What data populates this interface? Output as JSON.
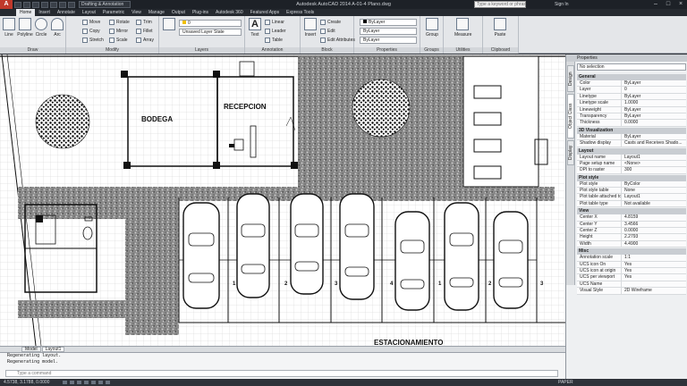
{
  "titlebar": {
    "logo_letter": "A",
    "workspace": "Drafting & Annotation",
    "title": "Autodesk AutoCAD 2014    A-01-4 Plano.dwg",
    "search_placeholder": "Type a keyword or phrase",
    "signin_label": "Sign In",
    "minimize": "–",
    "maximize": "□",
    "close": "×"
  },
  "ribbon_tabs": [
    "Home",
    "Insert",
    "Annotate",
    "Layout",
    "Parametric",
    "View",
    "Manage",
    "Output",
    "Plug-ins",
    "Autodesk 360",
    "Featured Apps",
    "Express Tools"
  ],
  "ribbon": {
    "draw": {
      "label": "Draw",
      "line": "Line",
      "polyline": "Polyline",
      "circle": "Circle",
      "arc": "Arc"
    },
    "modify": {
      "label": "Modify",
      "move": "Move",
      "rotate": "Rotate",
      "trim": "Trim",
      "copy": "Copy",
      "mirror": "Mirror",
      "fillet": "Fillet",
      "stretch": "Stretch",
      "scale": "Scale",
      "array": "Array"
    },
    "layers": {
      "label": "Layers",
      "state": "Unsaved Layer State"
    },
    "annotation": {
      "label": "Annotation",
      "text": "Text",
      "linear": "Linear",
      "leader": "Leader",
      "table": "Table"
    },
    "block": {
      "label": "Block",
      "insert": "Insert",
      "create": "Create",
      "edit": "Edit",
      "edit_attributes": "Edit Attributes"
    },
    "properties": {
      "label": "Properties",
      "bylayer1": "ByLayer",
      "bylayer2": "ByLayer",
      "bylayer3": "ByLayer"
    },
    "groups": {
      "label": "Groups",
      "group": "Group"
    },
    "utilities": {
      "label": "Utilities",
      "measure": "Measure"
    },
    "clipboard": {
      "label": "Clipboard",
      "paste": "Paste"
    }
  },
  "drawing": {
    "room_bodega": "BODEGA",
    "room_recepcion": "RECEPCION",
    "parking": "ESTACIONAMIENTO",
    "stall_numbers": [
      "1",
      "2",
      "3",
      "4",
      "1",
      "2",
      "3"
    ]
  },
  "layout_tabs": [
    "Model",
    "Layout1"
  ],
  "command": {
    "history": [
      "Regenerating layout.",
      "Regenerating model."
    ],
    "input_placeholder": "Type a command"
  },
  "status": {
    "coords": "4.5738, 3.1788, 0.0000",
    "paper": "PAPER"
  },
  "properties": {
    "title": "Properties",
    "selection": "No selection",
    "side_tabs": [
      "Design",
      "Object Class",
      "Display"
    ],
    "sections": [
      {
        "name": "General",
        "rows": [
          {
            "name": "Color",
            "value": "ByLayer"
          },
          {
            "name": "Layer",
            "value": "0"
          },
          {
            "name": "Linetype",
            "value": "ByLayer"
          },
          {
            "name": "Linetype scale",
            "value": "1.0000"
          },
          {
            "name": "Lineweight",
            "value": "ByLayer"
          },
          {
            "name": "Transparency",
            "value": "ByLayer"
          },
          {
            "name": "Thickness",
            "value": "0.0000"
          }
        ]
      },
      {
        "name": "3D Visualization",
        "rows": [
          {
            "name": "Material",
            "value": "ByLayer"
          },
          {
            "name": "Shadow display",
            "value": "Casts and Receives Shado..."
          }
        ]
      },
      {
        "name": "Layout",
        "rows": [
          {
            "name": "Layout name",
            "value": "Layout1"
          },
          {
            "name": "Page setup name",
            "value": "<None>"
          },
          {
            "name": "DPI to raster",
            "value": "300"
          }
        ]
      },
      {
        "name": "Plot style",
        "rows": [
          {
            "name": "Plot style",
            "value": "ByColor"
          },
          {
            "name": "Plot style table",
            "value": "None"
          },
          {
            "name": "Plot table attached to",
            "value": "Layout1"
          },
          {
            "name": "Plot table type",
            "value": "Not available"
          }
        ]
      },
      {
        "name": "View",
        "rows": [
          {
            "name": "Center X",
            "value": "4.8159"
          },
          {
            "name": "Center Y",
            "value": "3.4566"
          },
          {
            "name": "Center Z",
            "value": "0.0000"
          },
          {
            "name": "Height",
            "value": "2.2793"
          },
          {
            "name": "Width",
            "value": "4.4900"
          }
        ]
      },
      {
        "name": "Misc",
        "rows": [
          {
            "name": "Annotation scale",
            "value": "1:1"
          },
          {
            "name": "UCS icon On",
            "value": "Yes"
          },
          {
            "name": "UCS icon at origin",
            "value": "Yes"
          },
          {
            "name": "UCS per viewport",
            "value": "Yes"
          },
          {
            "name": "UCS Name",
            "value": ""
          },
          {
            "name": "Visual Style",
            "value": "2D Wireframe"
          }
        ]
      }
    ]
  }
}
